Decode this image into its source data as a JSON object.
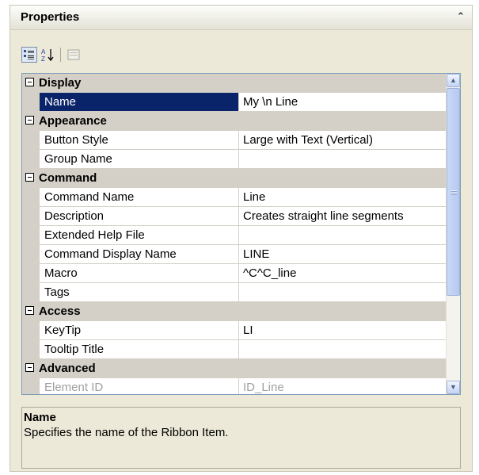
{
  "panel": {
    "title": "Properties"
  },
  "toolbar": {
    "buttons": [
      {
        "name": "categorized-view",
        "icon": "categorized-icon",
        "active": true
      },
      {
        "name": "alphabetical-view",
        "icon": "sort-az-icon",
        "active": false
      },
      {
        "name": "property-pages",
        "icon": "property-pages-icon",
        "active": false,
        "disabled": true
      }
    ]
  },
  "grid": {
    "categories": [
      {
        "label": "Display",
        "properties": [
          {
            "name": "Name",
            "value": "My \\n Line",
            "selected": true
          }
        ]
      },
      {
        "label": "Appearance",
        "properties": [
          {
            "name": "Button Style",
            "value": "Large with Text (Vertical)"
          },
          {
            "name": "Group Name",
            "value": ""
          }
        ]
      },
      {
        "label": "Command",
        "properties": [
          {
            "name": "Command Name",
            "value": "Line"
          },
          {
            "name": "Description",
            "value": "Creates straight line segments"
          },
          {
            "name": "Extended Help File",
            "value": ""
          },
          {
            "name": "Command Display Name",
            "value": "LINE"
          },
          {
            "name": "Macro",
            "value": "^C^C_line"
          },
          {
            "name": "Tags",
            "value": ""
          }
        ]
      },
      {
        "label": "Access",
        "properties": [
          {
            "name": "KeyTip",
            "value": "LI"
          },
          {
            "name": "Tooltip Title",
            "value": ""
          }
        ]
      },
      {
        "label": "Advanced",
        "properties": [
          {
            "name": "Element ID",
            "value": "ID_Line",
            "disabled": true
          }
        ]
      }
    ]
  },
  "help": {
    "title": "Name",
    "text": "Specifies the name of the Ribbon Item."
  },
  "colors": {
    "selection": "#0a246a",
    "category_band": "#d4d0c8",
    "panel_bg": "#ece9d8"
  }
}
